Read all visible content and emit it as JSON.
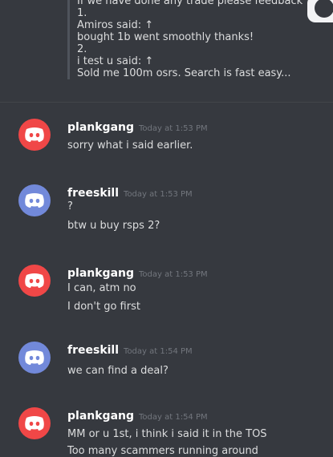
{
  "quote": {
    "lines": [
      "If we have done any trade please feedback",
      "1.",
      "Amiros said: ↑",
      "bought 1b went smoothly thanks!",
      "2.",
      "i test u said: ↑",
      "Sold me 100m osrs. Search is fast easy..."
    ]
  },
  "messages": [
    {
      "user": "plankgang",
      "time": "Today at 1:53 PM",
      "lines": [
        "sorry what i said earlier."
      ]
    },
    {
      "user": "freeskill",
      "time": "Today at 1:53 PM",
      "lines": [
        "?",
        "btw u buy rsps 2?"
      ]
    },
    {
      "user": "plankgang",
      "time": "Today at 1:53 PM",
      "lines": [
        "I can, atm no",
        "I don't go first"
      ]
    },
    {
      "user": "freeskill",
      "time": "Today at 1:54 PM",
      "lines": [
        "we can find a deal?"
      ]
    },
    {
      "user": "plankgang",
      "time": "Today at 1:54 PM",
      "lines": [
        "MM or u 1st, i think i said it in the TOS",
        "Too many scammers running around"
      ]
    }
  ],
  "colors": {
    "background": "#36393f",
    "avatar_plankgang": "#f04747",
    "avatar_freeskill": "#7289da"
  },
  "icons": {
    "avatar": "discord-logo-icon"
  }
}
